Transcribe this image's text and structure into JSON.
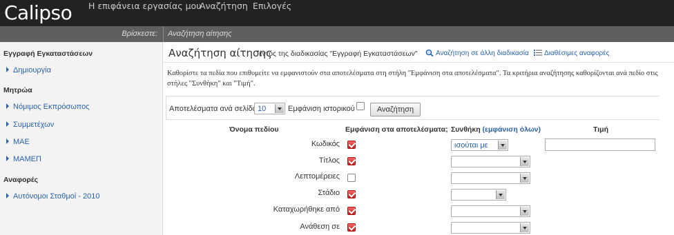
{
  "app": {
    "logo": "Calipso",
    "nav": [
      "Η επιφάνεια εργασίας μου",
      "Αναζήτηση",
      "Επιλογές"
    ]
  },
  "breadcrumb": {
    "label": "Βρίσκεστε:",
    "current": "Αναζήτηση αίτησης"
  },
  "sidebar": {
    "sections": [
      {
        "title": "Εγγραφή Εγκαταστάσεων",
        "items": [
          "Δημιουργία"
        ]
      },
      {
        "title": "Μητρώα",
        "items": [
          "Νόμιμος Εκπρόσωπος",
          "Συμμετέχων",
          "ΜΑΕ",
          "ΜΑΜΕΠ"
        ]
      },
      {
        "title": "Αναφορές",
        "items": [
          "Αυτόνομοι Σταθμοί - 2010"
        ]
      }
    ]
  },
  "main": {
    "title": "Αναζήτηση αίτησης",
    "subtitle": "εντός της διαδικασίας \"Εγγραφή Εγκαταστάσεων\"",
    "link_search_other": "Αναζήτηση σε άλλη διαδικασία",
    "link_reports": "Διαθέσιμες αναφορές",
    "description": "Καθορίστε τα πεδία που επιθυμείτε να εμφανιστούν στα αποτελέσματα στη στήλη \"Εμφάνιση στα αποτελέσματα\". Τα κριτήρια αναζήτησης καθορίζονται ανά πεδίο στις στήλες \"Συνθήκη\" και \"Τιμή\".",
    "results_per_page_label": "Αποτελέσματα ανά σελίδα",
    "results_per_page_value": "10",
    "show_history_label": "Εμφάνιση ιστορικού",
    "search_button": "Αναζήτηση"
  },
  "table": {
    "col_field": "Όνομα πεδίου",
    "col_show": "Εμφάνιση στα αποτελέσματα;",
    "col_condition": "Συνθήκη",
    "col_condition_link": "(εμφάνιση όλων)",
    "col_value": "Τιμή",
    "rows": [
      {
        "label": "Κωδικός",
        "checked": true,
        "condition": "ισούται με"
      },
      {
        "label": "Τίτλος",
        "checked": true,
        "condition": ""
      },
      {
        "label": "Λεπτομέρειες",
        "checked": false,
        "condition": ""
      },
      {
        "label": "Στάδιο",
        "checked": true,
        "condition": ""
      },
      {
        "label": "Καταχωρήθηκε από",
        "checked": true,
        "condition": ""
      },
      {
        "label": "Ανάθεση σε",
        "checked": true,
        "condition": ""
      }
    ]
  }
}
